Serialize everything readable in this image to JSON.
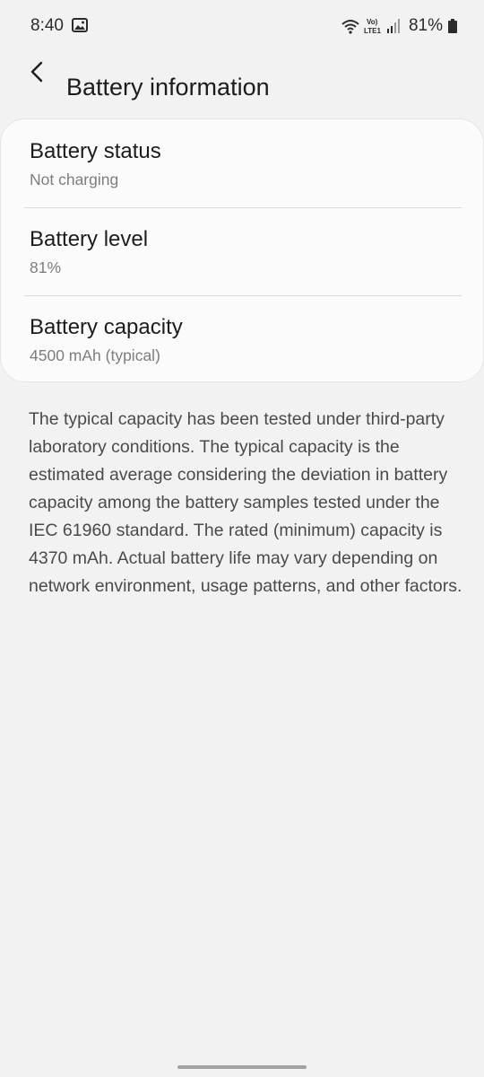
{
  "status_bar": {
    "time": "8:40",
    "network_label": "Vo) LTE1",
    "battery_percent": "81%",
    "icons": [
      "gallery-icon",
      "wifi-icon",
      "volte-lte-icon",
      "signal-icon",
      "battery-icon"
    ]
  },
  "header": {
    "title": "Battery information",
    "back_icon": "back-arrow-icon"
  },
  "battery_info": {
    "items": [
      {
        "label": "Battery status",
        "value": "Not charging"
      },
      {
        "label": "Battery level",
        "value": "81%"
      },
      {
        "label": "Battery capacity",
        "value": "4500 mAh (typical)"
      }
    ]
  },
  "description": "The typical capacity has been tested under third-party laboratory conditions. The typical capacity is the estimated average considering the deviation in battery capacity among the battery samples tested under the IEC 61960 standard. The rated (minimum) capacity is 4370 mAh. Actual battery life may vary depending on network environment, usage patterns, and other factors.",
  "colors": {
    "background": "#f2f2f2",
    "card": "#fbfbfb",
    "text_primary": "#1c1c1c",
    "text_secondary": "#7d7d7d"
  }
}
